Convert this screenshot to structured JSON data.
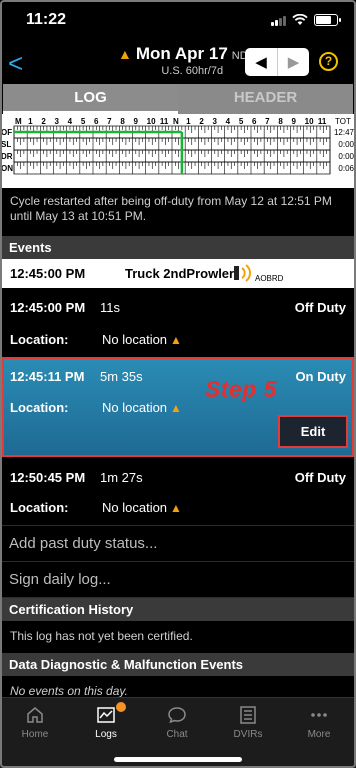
{
  "status_bar": {
    "time": "11:22"
  },
  "header": {
    "back": "<",
    "date": "Mon Apr 17",
    "timezone": "NDT",
    "cycle": "U.S. 60hr/7d",
    "prev": "◀",
    "next": "▶",
    "help": "?"
  },
  "tabs": {
    "log": "LOG",
    "header": "HEADER"
  },
  "graph": {
    "hours": [
      "M",
      "1",
      "2",
      "3",
      "4",
      "5",
      "6",
      "7",
      "8",
      "9",
      "10",
      "11",
      "N",
      "1",
      "2",
      "3",
      "4",
      "5",
      "6",
      "7",
      "8",
      "9",
      "10",
      "11"
    ],
    "tot_label": "TOT",
    "rows": [
      {
        "label": "OF",
        "total": "12:47"
      },
      {
        "label": "SL",
        "total": "0:00"
      },
      {
        "label": "DR",
        "total": "0:00"
      },
      {
        "label": "ON",
        "total": "0:06"
      }
    ]
  },
  "cycle_note": "Cycle restarted after being off-duty from May 12 at 12:51 PM until May 13 at 10:51 PM.",
  "events_header": "Events",
  "truck_event": {
    "time": "12:45:00 PM",
    "truck": "Truck 2ndProwler",
    "source": "AOBRD"
  },
  "events": [
    {
      "time": "12:45:00 PM",
      "duration": "11s",
      "status": "Off Duty",
      "location_label": "Location:",
      "location": "No location"
    },
    {
      "time": "12:45:11 PM",
      "duration": "5m 35s",
      "status": "On Duty",
      "location_label": "Location:",
      "location": "No location"
    },
    {
      "time": "12:50:45 PM",
      "duration": "1m 27s",
      "status": "Off Duty",
      "location_label": "Location:",
      "location": "No location"
    }
  ],
  "step_label": "Step 5",
  "edit_label": "Edit",
  "add_past": "Add past duty status...",
  "sign_log": "Sign daily log...",
  "cert_header": "Certification History",
  "cert_msg": "This log has not yet been certified.",
  "diag_header": "Data Diagnostic & Malfunction Events",
  "diag_msg": "No events on this day.",
  "tabbar": [
    {
      "label": "Home",
      "icon": "home-icon"
    },
    {
      "label": "Logs",
      "icon": "logs-icon"
    },
    {
      "label": "Chat",
      "icon": "chat-icon"
    },
    {
      "label": "DVIRs",
      "icon": "dvir-icon"
    },
    {
      "label": "More",
      "icon": "more-icon"
    }
  ],
  "colors": {
    "accent_blue": "#2fa6e8",
    "warning": "#f2a20c",
    "highlight_red": "#e23030",
    "graph_line": "#19b436"
  }
}
